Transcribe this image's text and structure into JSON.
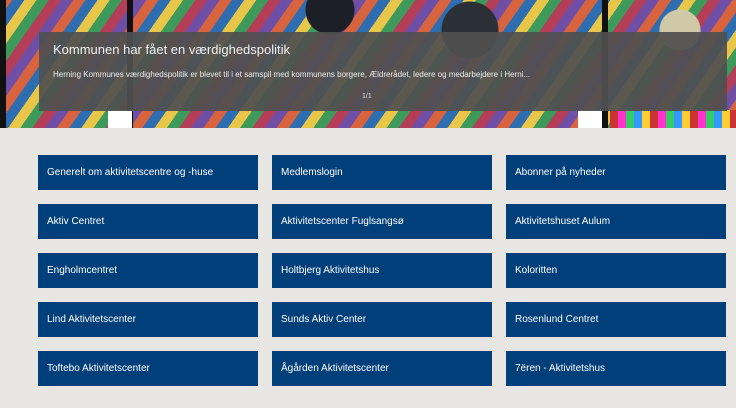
{
  "banner": {
    "title": "Kommunen har fået en værdighedspolitik",
    "description": "Herning Kommunes værdighedspolitik er blevet til i et samspil med kommunens borgere, Ældrerådet, ledere og medarbejdere i Herni...",
    "pager": "1/1"
  },
  "tiles": [
    {
      "label": "Generelt om aktivitetscentre og -huse"
    },
    {
      "label": "Medlemslogin"
    },
    {
      "label": "Abonner på nyheder"
    },
    {
      "label": "Aktiv Centret"
    },
    {
      "label": "Aktivitetscenter Fuglsangsø"
    },
    {
      "label": "Aktivitetshuset Aulum"
    },
    {
      "label": "Engholmcentret"
    },
    {
      "label": "Holtbjerg Aktivitetshus"
    },
    {
      "label": "Koloritten"
    },
    {
      "label": "Lind Aktivitetscenter"
    },
    {
      "label": "Sunds Aktiv Center"
    },
    {
      "label": "Rosenlund Centret"
    },
    {
      "label": "Toftebo Aktivitetscenter"
    },
    {
      "label": "Ågården Aktivitetscenter"
    },
    {
      "label": "7ëren - Aktivitetshus"
    }
  ],
  "colors": {
    "tile_background": "#003f7a",
    "page_background": "#e8e6e3",
    "overlay_background": "#505050"
  }
}
